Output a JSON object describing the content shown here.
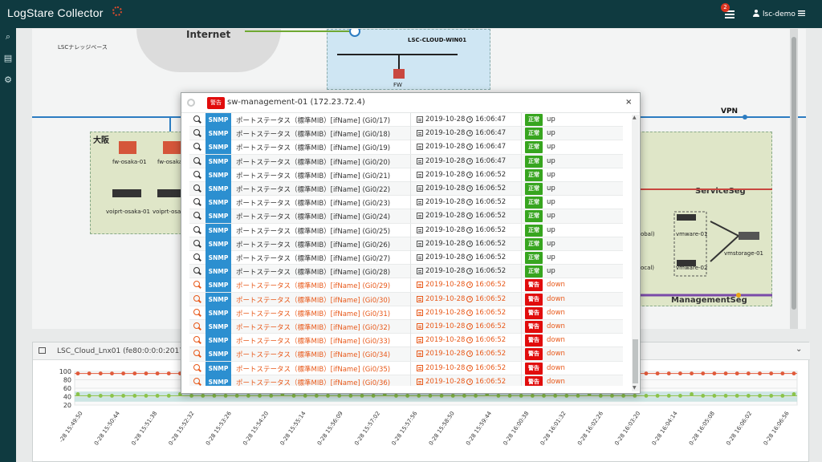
{
  "app": {
    "title": "LogStare Collector",
    "notification_count": "2",
    "user": "lsc-demo"
  },
  "diagram": {
    "internet": "Internet",
    "kb": "LSCナレッジベース",
    "cloud_win": "LSC-CLOUD-WIN01",
    "fw": "FW",
    "osaka": "大阪",
    "fw_osaka_01": "fw-osaka-01",
    "fw_osaka_02": "fw-osaka",
    "voip_01": "voiprt-osaka-01",
    "voip_02": "voiprt-osa",
    "vpn": "VPN",
    "service_seg": "ServiceSeg",
    "management_seg": "ManagementSeg",
    "vmware_01": "vmware-01",
    "vmware_02": "vmware-02",
    "vmstorage": "vmstorage-01",
    "global": "lobal)",
    "local": "local)"
  },
  "panel2": {
    "title": "LSC_Cloud_Lnx01 (fe80:0:0:0:2017"
  },
  "modal": {
    "badge": "警告",
    "title": "sw-management-01 (172.23.72.4)",
    "close": "×",
    "rows": [
      {
        "tag": "SNMP",
        "desc": "ポートステータス（標準MIB）[ifName] (Gi0/17)",
        "date": "2019-10-28",
        "time": "16:06:47",
        "status": "正常",
        "value": "up"
      },
      {
        "tag": "SNMP",
        "desc": "ポートステータス（標準MIB）[ifName] (Gi0/18)",
        "date": "2019-10-28",
        "time": "16:06:47",
        "status": "正常",
        "value": "up"
      },
      {
        "tag": "SNMP",
        "desc": "ポートステータス（標準MIB）[ifName] (Gi0/19)",
        "date": "2019-10-28",
        "time": "16:06:47",
        "status": "正常",
        "value": "up"
      },
      {
        "tag": "SNMP",
        "desc": "ポートステータス（標準MIB）[ifName] (Gi0/20)",
        "date": "2019-10-28",
        "time": "16:06:47",
        "status": "正常",
        "value": "up"
      },
      {
        "tag": "SNMP",
        "desc": "ポートステータス（標準MIB）[ifName] (Gi0/21)",
        "date": "2019-10-28",
        "time": "16:06:52",
        "status": "正常",
        "value": "up"
      },
      {
        "tag": "SNMP",
        "desc": "ポートステータス（標準MIB）[ifName] (Gi0/22)",
        "date": "2019-10-28",
        "time": "16:06:52",
        "status": "正常",
        "value": "up"
      },
      {
        "tag": "SNMP",
        "desc": "ポートステータス（標準MIB）[ifName] (Gi0/23)",
        "date": "2019-10-28",
        "time": "16:06:52",
        "status": "正常",
        "value": "up"
      },
      {
        "tag": "SNMP",
        "desc": "ポートステータス（標準MIB）[ifName] (Gi0/24)",
        "date": "2019-10-28",
        "time": "16:06:52",
        "status": "正常",
        "value": "up"
      },
      {
        "tag": "SNMP",
        "desc": "ポートステータス（標準MIB）[ifName] (Gi0/25)",
        "date": "2019-10-28",
        "time": "16:06:52",
        "status": "正常",
        "value": "up"
      },
      {
        "tag": "SNMP",
        "desc": "ポートステータス（標準MIB）[ifName] (Gi0/26)",
        "date": "2019-10-28",
        "time": "16:06:52",
        "status": "正常",
        "value": "up"
      },
      {
        "tag": "SNMP",
        "desc": "ポートステータス（標準MIB）[ifName] (Gi0/27)",
        "date": "2019-10-28",
        "time": "16:06:52",
        "status": "正常",
        "value": "up"
      },
      {
        "tag": "SNMP",
        "desc": "ポートステータス（標準MIB）[ifName] (Gi0/28)",
        "date": "2019-10-28",
        "time": "16:06:52",
        "status": "正常",
        "value": "up"
      },
      {
        "tag": "SNMP",
        "desc": "ポートステータス（標準MIB）[ifName] (Gi0/29)",
        "date": "2019-10-28",
        "time": "16:06:52",
        "status": "警告",
        "value": "down"
      },
      {
        "tag": "SNMP",
        "desc": "ポートステータス（標準MIB）[ifName] (Gi0/30)",
        "date": "2019-10-28",
        "time": "16:06:52",
        "status": "警告",
        "value": "down"
      },
      {
        "tag": "SNMP",
        "desc": "ポートステータス（標準MIB）[ifName] (Gi0/31)",
        "date": "2019-10-28",
        "time": "16:06:52",
        "status": "警告",
        "value": "down"
      },
      {
        "tag": "SNMP",
        "desc": "ポートステータス（標準MIB）[ifName] (Gi0/32)",
        "date": "2019-10-28",
        "time": "16:06:52",
        "status": "警告",
        "value": "down"
      },
      {
        "tag": "SNMP",
        "desc": "ポートステータス（標準MIB）[ifName] (Gi0/33)",
        "date": "2019-10-28",
        "time": "16:06:52",
        "status": "警告",
        "value": "down"
      },
      {
        "tag": "SNMP",
        "desc": "ポートステータス（標準MIB）[ifName] (Gi0/34)",
        "date": "2019-10-28",
        "time": "16:06:52",
        "status": "警告",
        "value": "down"
      },
      {
        "tag": "SNMP",
        "desc": "ポートステータス（標準MIB）[ifName] (Gi0/35)",
        "date": "2019-10-28",
        "time": "16:06:52",
        "status": "警告",
        "value": "down"
      },
      {
        "tag": "SNMP",
        "desc": "ポートステータス（標準MIB）[ifName] (Gi0/36)",
        "date": "2019-10-28",
        "time": "16:06:52",
        "status": "警告",
        "value": "down"
      }
    ]
  },
  "chart_data": {
    "type": "line",
    "yticks": [
      "100",
      "80",
      "60",
      "40",
      "20"
    ],
    "ylim": [
      20,
      100
    ],
    "series": [
      {
        "color": "#e05a3a",
        "value": 95
      },
      {
        "color": "#8bc34a",
        "value": 42
      }
    ],
    "x_ticks": [
      "-28 15:49:50",
      "0-28 15:50:44",
      "0-28 15:51:38",
      "0-28 15:52:32",
      "0-28 15:53:26",
      "0-28 15:54:20",
      "0-28 15:55:14",
      "0-28 15:56:09",
      "0-28 15:57:02",
      "0-28 15:57:56",
      "0-28 15:58:50",
      "0-28 15:59:44",
      "0-28 16:00:38",
      "0-28 16:01:32",
      "0-28 16:02:26",
      "0-28 16:03:20",
      "0-28 16:04:14",
      "0-28 16:05:08",
      "0-28 16:06:02",
      "0-28 16:06:56"
    ]
  },
  "colors": {
    "topbar": "#0f3a40",
    "snmp": "#2c8fd0",
    "ok": "#37a51f",
    "warn": "#e10c0c",
    "down_text": "#e8591a"
  }
}
